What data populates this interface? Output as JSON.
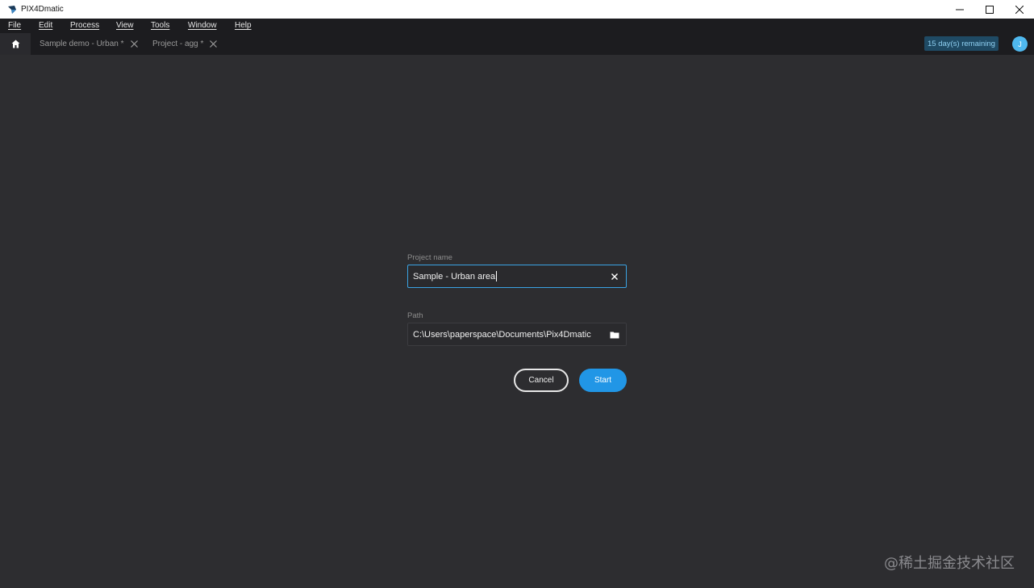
{
  "window": {
    "title": "PIX4Dmatic"
  },
  "menu": {
    "items": [
      "File",
      "Edit",
      "Process",
      "View",
      "Tools",
      "Window",
      "Help"
    ]
  },
  "tabs": [
    {
      "label": "Sample demo - Urban *"
    },
    {
      "label": "Project - agg *"
    }
  ],
  "trial": {
    "badge": "15 day(s) remaining"
  },
  "user": {
    "initial": "J"
  },
  "form": {
    "project_name_label": "Project name",
    "project_name_value": "Sample - Urban area",
    "path_label": "Path",
    "path_value": "C:\\Users\\paperspace\\Documents\\Pix4Dmatic",
    "cancel_label": "Cancel",
    "start_label": "Start"
  },
  "watermark": "@稀土掘金技术社区",
  "colors": {
    "accent": "#2196e6",
    "background": "#2d2d30",
    "menubar": "#1c1c1f"
  }
}
